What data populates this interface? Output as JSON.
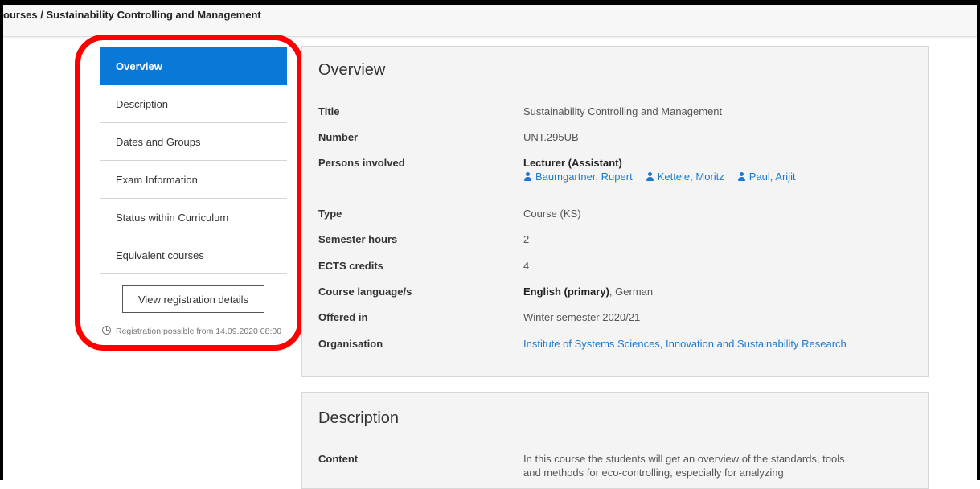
{
  "header": {
    "breadcrumb": "ourses / Sustainability Controlling and Management"
  },
  "sidebar": {
    "items": [
      {
        "label": "Overview",
        "active": true
      },
      {
        "label": "Description"
      },
      {
        "label": "Dates and Groups"
      },
      {
        "label": "Exam Information"
      },
      {
        "label": "Status within Curriculum"
      },
      {
        "label": "Equivalent courses"
      }
    ],
    "registration_button": "View registration details",
    "registration_note": "Registration possible from 14.09.2020 08:00"
  },
  "overview": {
    "title": "Overview",
    "rows": {
      "title": {
        "label": "Title",
        "value": "Sustainability Controlling and Management"
      },
      "number": {
        "label": "Number",
        "value": "UNT.295UB"
      },
      "persons": {
        "label": "Persons involved",
        "role": "Lecturer (Assistant)",
        "people": [
          "Baumgartner, Rupert",
          "Kettele, Moritz",
          "Paul, Arijit"
        ]
      },
      "type": {
        "label": "Type",
        "value": "Course (KS)"
      },
      "semester_hours": {
        "label": "Semester hours",
        "value": "2"
      },
      "ects": {
        "label": "ECTS credits",
        "value": "4"
      },
      "language": {
        "label": "Course language/s",
        "primary": "English (primary)",
        "secondary": ", German"
      },
      "offered": {
        "label": "Offered in",
        "value": "Winter semester 2020/21"
      },
      "organisation": {
        "label": "Organisation",
        "value": "Institute of Systems Sciences, Innovation and Sustainability Research"
      }
    }
  },
  "description": {
    "title": "Description",
    "content_label": "Content",
    "content_text": "In this course the students will get an overview of the standards, tools and methods for eco-controlling, especially for analyzing"
  },
  "colors": {
    "accent": "#0a78d7",
    "link": "#1a7ad3",
    "highlight": "#ff0000"
  }
}
